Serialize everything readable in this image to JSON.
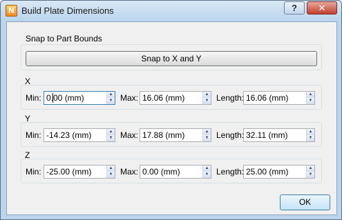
{
  "window": {
    "title": "Build Plate Dimensions",
    "app_icon_letter": "N",
    "help_label": "?",
    "close_label": "✕"
  },
  "snap": {
    "group_label": "Snap to Part Bounds",
    "button_label": "Snap to X and Y"
  },
  "labels": {
    "min": "Min:",
    "max": "Max:",
    "length": "Length:"
  },
  "axes": [
    {
      "name": "X",
      "min": "0.00 (mm)",
      "max": "16.06 (mm)",
      "length": "16.06 (mm)"
    },
    {
      "name": "Y",
      "min": "-14.23 (mm)",
      "max": "17.88 (mm)",
      "length": "32.11 (mm)"
    },
    {
      "name": "Z",
      "min": "-25.00 (mm)",
      "max": "0.00 (mm)",
      "length": "25.00 (mm)"
    }
  ],
  "footer": {
    "ok_label": "OK"
  },
  "spin_up": "▲",
  "spin_down": "▼"
}
